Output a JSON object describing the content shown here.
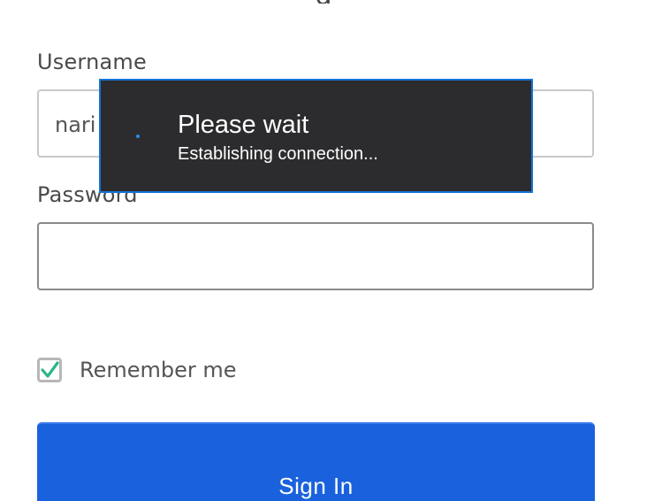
{
  "form": {
    "heading_partial": "g",
    "username": {
      "label": "Username",
      "value": "nari"
    },
    "password": {
      "label": "Password",
      "value": ""
    },
    "remember_me": {
      "label": "Remember me",
      "checked": true
    },
    "submit_label": "Sign In"
  },
  "dialog": {
    "title": "Please wait",
    "message": "Establishing connection..."
  },
  "colors": {
    "primary_button": "#1a62dd",
    "dialog_background": "#2c2c2e",
    "dialog_border": "#1574d8",
    "checkmark": "#2bb58b",
    "label_text": "#4a4a4a"
  },
  "icons": {
    "checkbox": "checkmark-icon",
    "spinner": "loading-spinner-icon"
  }
}
